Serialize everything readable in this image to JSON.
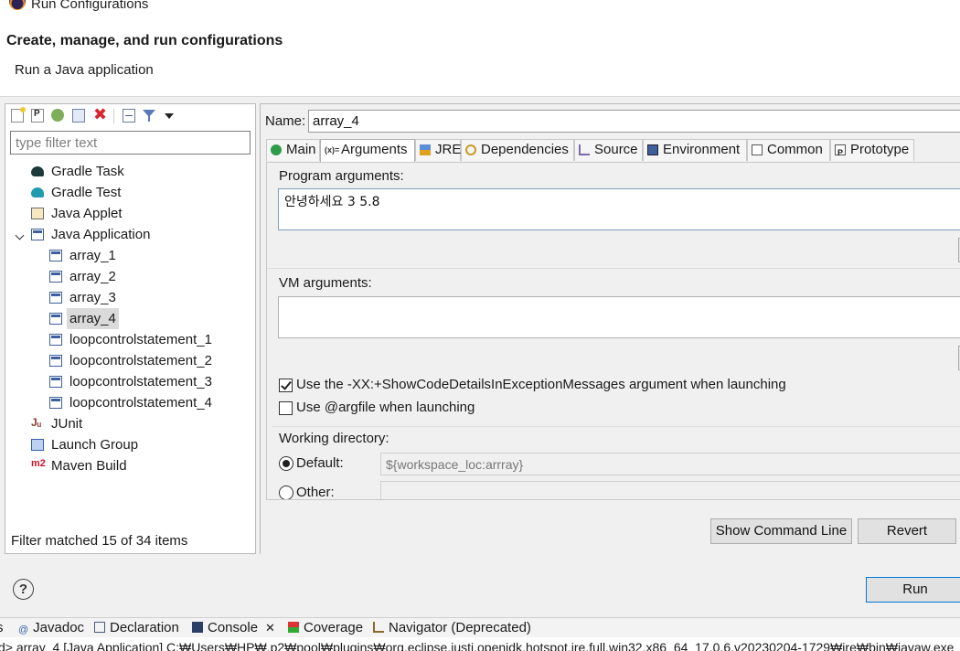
{
  "window": {
    "title": "Run Configurations"
  },
  "header": {
    "title": "Create, manage, and run configurations",
    "subtitle": "Run a Java application"
  },
  "left": {
    "toolbar_icons": [
      "new-config-icon",
      "new-prototype-icon",
      "export-icon",
      "duplicate-icon",
      "delete-icon",
      "collapse-all-icon",
      "filter-icon",
      "view-menu-icon"
    ],
    "filter_placeholder": "type filter text",
    "tree": [
      {
        "label": "Gradle Task",
        "icon": "gradle-task-icon"
      },
      {
        "label": "Gradle Test",
        "icon": "gradle-test-icon"
      },
      {
        "label": "Java Applet",
        "icon": "java-applet-icon"
      },
      {
        "label": "Java Application",
        "icon": "java-application-icon",
        "expanded": true,
        "children": [
          "array_1",
          "array_2",
          "array_3",
          "array_4",
          "loopcontrolstatement_1",
          "loopcontrolstatement_2",
          "loopcontrolstatement_3",
          "loopcontrolstatement_4"
        ],
        "selected_child": "array_4"
      },
      {
        "label": "JUnit",
        "icon": "junit-icon"
      },
      {
        "label": "Launch Group",
        "icon": "launch-group-icon"
      },
      {
        "label": "Maven Build",
        "icon": "maven-icon"
      }
    ],
    "status": "Filter matched 15 of 34 items"
  },
  "right": {
    "name_label": "Name:",
    "name_value": "array_4",
    "tabs": [
      {
        "label": "Main",
        "active": false
      },
      {
        "label": "Arguments",
        "active": true
      },
      {
        "label": "JRE",
        "active": false
      },
      {
        "label": "Dependencies",
        "active": false
      },
      {
        "label": "Source",
        "active": false
      },
      {
        "label": "Environment",
        "active": false
      },
      {
        "label": "Common",
        "active": false
      },
      {
        "label": "Prototype",
        "active": false
      }
    ],
    "program_args_label": "Program arguments:",
    "program_args_value": "안녕하세요 3 5.8",
    "vm_args_label": "VM arguments:",
    "vm_args_value": "",
    "checkbox_showcode": {
      "label": "Use the -XX:+ShowCodeDetailsInExceptionMessages argument when launching",
      "checked": true
    },
    "checkbox_argfile": {
      "label": "Use @argfile when launching",
      "checked": false
    },
    "working_dir_label": "Working directory:",
    "radio_default": {
      "label": "Default:",
      "checked": true
    },
    "radio_other": {
      "label": "Other:",
      "checked": false
    },
    "default_dir_value": "${workspace_loc:arrray}",
    "show_command_line": "Show Command Line",
    "revert": "Revert"
  },
  "footer": {
    "help": "?",
    "run": "Run"
  },
  "views": {
    "tabs": [
      "s",
      "Javadoc",
      "Declaration",
      "Console",
      "Coverage",
      "Navigator (Deprecated)"
    ],
    "console_close": "✕",
    "console_text": "d> array_4 [Java Application] C:₩Users₩HP₩.p2₩pool₩plugins₩org.eclipse.justj.openjdk.hotspot.jre.full.win32.x86_64_17.0.6.v20230204-1729₩jre₩bin₩javaw.exe"
  },
  "colors": {
    "accent": "#0078d7",
    "delete": "#d6262f",
    "selection": "#dadada"
  }
}
